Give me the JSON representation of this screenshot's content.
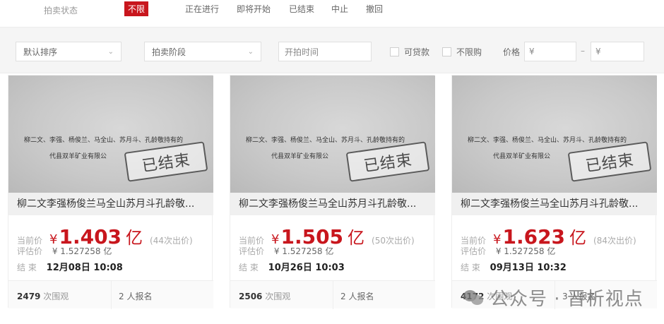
{
  "status_bar": {
    "label": "拍卖状态",
    "tabs": [
      "不限",
      "正在进行",
      "即将开始",
      "已结束",
      "中止",
      "撤回"
    ]
  },
  "filters": {
    "sort": "默认排序",
    "stage": "拍卖阶段",
    "start_time": "开拍时间",
    "loan_label": "可贷款",
    "unlimited_label": "不限购",
    "price_label": "价格",
    "price_min": "¥",
    "price_max": "¥",
    "price_sep": "–"
  },
  "labels": {
    "current_price": "当前价",
    "evaluated_price": "评估价",
    "end": "结 束",
    "views_suffix": "次围观",
    "signups_suffix": "人报名",
    "stamp": "已结束",
    "doc_line1": "柳二文、李强、杨俊兰、马全山、苏月斗、孔龄敬持有的",
    "doc_line2": "代县双羊矿业有限公"
  },
  "cards": [
    {
      "title": "柳二文李强杨俊兰马全山苏月斗孔龄敬...",
      "currency": "¥",
      "price": "1.403",
      "unit": "亿",
      "bids": "(44次出价)",
      "evaluated": "¥ 1.527258 亿",
      "end_time": "12月08日 10:08",
      "views": "2479",
      "signups": "2"
    },
    {
      "title": "柳二文李强杨俊兰马全山苏月斗孔龄敬...",
      "currency": "¥",
      "price": "1.505",
      "unit": "亿",
      "bids": "(50次出价)",
      "evaluated": "¥ 1.527258 亿",
      "end_time": "10月26日 10:03",
      "views": "2506",
      "signups": "2"
    },
    {
      "title": "柳二文李强杨俊兰马全山苏月斗孔龄敬...",
      "currency": "¥",
      "price": "1.623",
      "unit": "亿",
      "bids": "(84次出价)",
      "evaluated": "¥ 1.527258 亿",
      "end_time": "09月13日 10:32",
      "views": "4172",
      "signups": "3"
    }
  ],
  "watermark": "公众号 · 晋析视点",
  "colors": {
    "accent": "#c8161d"
  }
}
